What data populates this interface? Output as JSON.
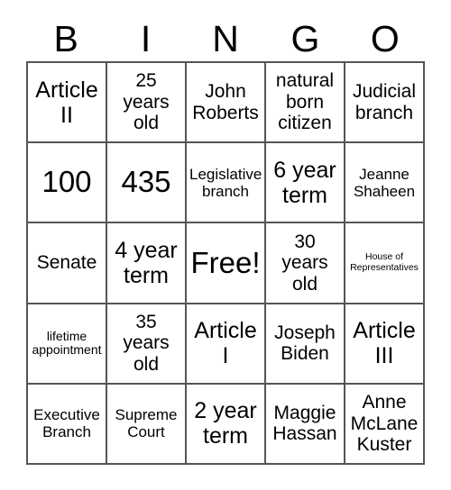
{
  "card": {
    "title": "BINGO",
    "header_letters": [
      "B",
      "I",
      "N",
      "G",
      "O"
    ],
    "rows": 5,
    "columns": 5,
    "border_color": "#555555",
    "text_color": "#000000",
    "background_color": "#ffffff",
    "free_space": "Free!",
    "cells": [
      {
        "text": "Article\nII",
        "size": "lg"
      },
      {
        "text": "25\nyears\nold",
        "size": "md"
      },
      {
        "text": "John\nRoberts",
        "size": "md"
      },
      {
        "text": "natural\nborn\ncitizen",
        "size": "md"
      },
      {
        "text": "Judicial\nbranch",
        "size": "md"
      },
      {
        "text": "100",
        "size": "xl"
      },
      {
        "text": "435",
        "size": "xl"
      },
      {
        "text": "Legislative\nbranch",
        "size": "sm"
      },
      {
        "text": "6 year\nterm",
        "size": "lg"
      },
      {
        "text": "Jeanne\nShaheen",
        "size": "sm"
      },
      {
        "text": "Senate",
        "size": "md"
      },
      {
        "text": "4 year\nterm",
        "size": "lg"
      },
      {
        "text": "Free!",
        "size": "xl"
      },
      {
        "text": "30\nyears\nold",
        "size": "md"
      },
      {
        "text": "House of\nRepresentatives",
        "size": "xxs"
      },
      {
        "text": "lifetime\nappointment",
        "size": "xs"
      },
      {
        "text": "35\nyears\nold",
        "size": "md"
      },
      {
        "text": "Article\nI",
        "size": "lg"
      },
      {
        "text": "Joseph\nBiden",
        "size": "md"
      },
      {
        "text": "Article\nIII",
        "size": "lg"
      },
      {
        "text": "Executive\nBranch",
        "size": "sm"
      },
      {
        "text": "Supreme\nCourt",
        "size": "sm"
      },
      {
        "text": "2 year\nterm",
        "size": "lg"
      },
      {
        "text": "Maggie\nHassan",
        "size": "md"
      },
      {
        "text": "Anne\nMcLane\nKuster",
        "size": "md"
      }
    ]
  }
}
